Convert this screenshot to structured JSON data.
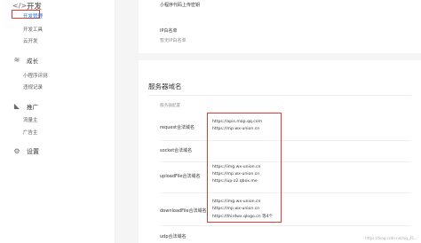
{
  "sidebar": {
    "groups": [
      {
        "title": "开发",
        "icon": "code-icon",
        "items": [
          "开发管理",
          "开发工具",
          "云开发"
        ]
      },
      {
        "title": "成长",
        "icon": "growth-icon",
        "items": [
          "小程序评测",
          "违规记录"
        ]
      },
      {
        "title": "推广",
        "icon": "promotion-icon",
        "items": [
          "流量主",
          "广告主"
        ]
      },
      {
        "title": "设置",
        "icon": "gear-icon",
        "items": []
      }
    ],
    "active_item": "开发管理"
  },
  "upper": {
    "upload_mode": "小程序代码上传密钥",
    "ip_whitelist_label": "IP白名单",
    "ip_whitelist_value": "暂无IP白名单"
  },
  "server_domains": {
    "title": "服务器域名",
    "subtitle": "服务器配置",
    "rows": [
      {
        "label": "request合法域名",
        "domains": [
          "https://apis.map.qq.com",
          "https://mp.wx-union.cn"
        ]
      },
      {
        "label": "socket合法域名",
        "domains": []
      },
      {
        "label": "uploadFile合法域名",
        "domains": [
          "https://img.wx-union.cn",
          "https://mp.wx-union.cn",
          "https://up-z2.qbox.me"
        ]
      },
      {
        "label": "downloadFile合法域名",
        "domains": [
          "https://img.wx-union.cn",
          "https://mp.wx-union.cn",
          "https://thirdwx.qlogo.cn 等4个"
        ]
      },
      {
        "label": "udp合法域名",
        "domains": []
      }
    ]
  },
  "watermark": "https://blog.csdn.net/qq_41..."
}
